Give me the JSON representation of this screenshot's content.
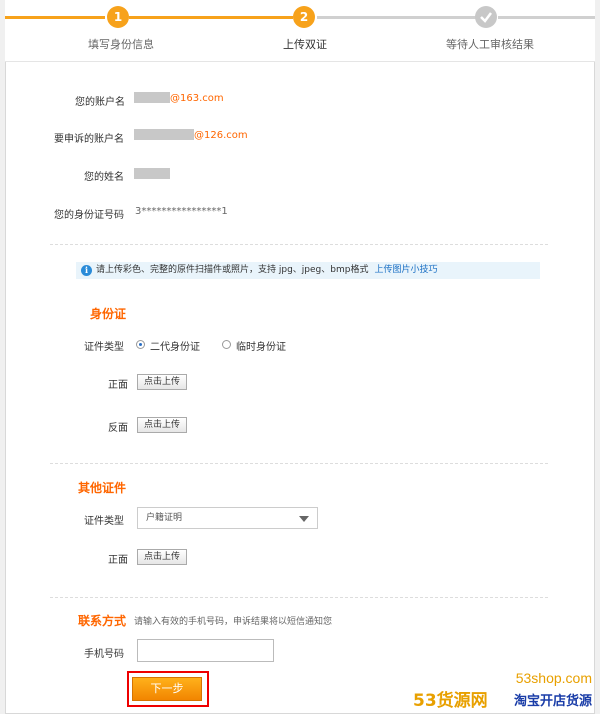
{
  "steps": [
    {
      "number": "1",
      "label": "填写身份信息"
    },
    {
      "number": "2",
      "label": "上传双证"
    },
    {
      "number": "",
      "label": "等待人工审核结果"
    }
  ],
  "account": {
    "label": "您的账户名",
    "domain": "@163.com"
  },
  "appeal_account": {
    "label": "要申诉的账户名",
    "domain": "@126.com"
  },
  "name": {
    "label": "您的姓名"
  },
  "id_number": {
    "label": "您的身份证号码",
    "value": "3****************1"
  },
  "tip": {
    "text": "请上传彩色、完整的原件扫描件或照片，支持 jpg、jpeg、bmp格式",
    "link": "上传图片小技巧"
  },
  "id_card": {
    "title": "身份证",
    "type_label": "证件类型",
    "option_1": "二代身份证",
    "option_2": "临时身份证",
    "front_label": "正面",
    "back_label": "反面",
    "upload_label": "点击上传"
  },
  "other_doc": {
    "title": "其他证件",
    "type_label": "证件类型",
    "selected": "户籍证明",
    "front_label": "正面",
    "upload_label": "点击上传"
  },
  "contact": {
    "title": "联系方式",
    "hint": "请输入有效的手机号码，申诉结果将以短信通知您",
    "phone_label": "手机号码"
  },
  "next_label": "下一步",
  "watermark": {
    "domain": "53shop.com",
    "brand": "53货源网",
    "slogan": "淘宝开店货源"
  },
  "colors": {
    "accent": "#f60",
    "step_active": "#f7a21b",
    "step_done": "#c8c8c8"
  }
}
